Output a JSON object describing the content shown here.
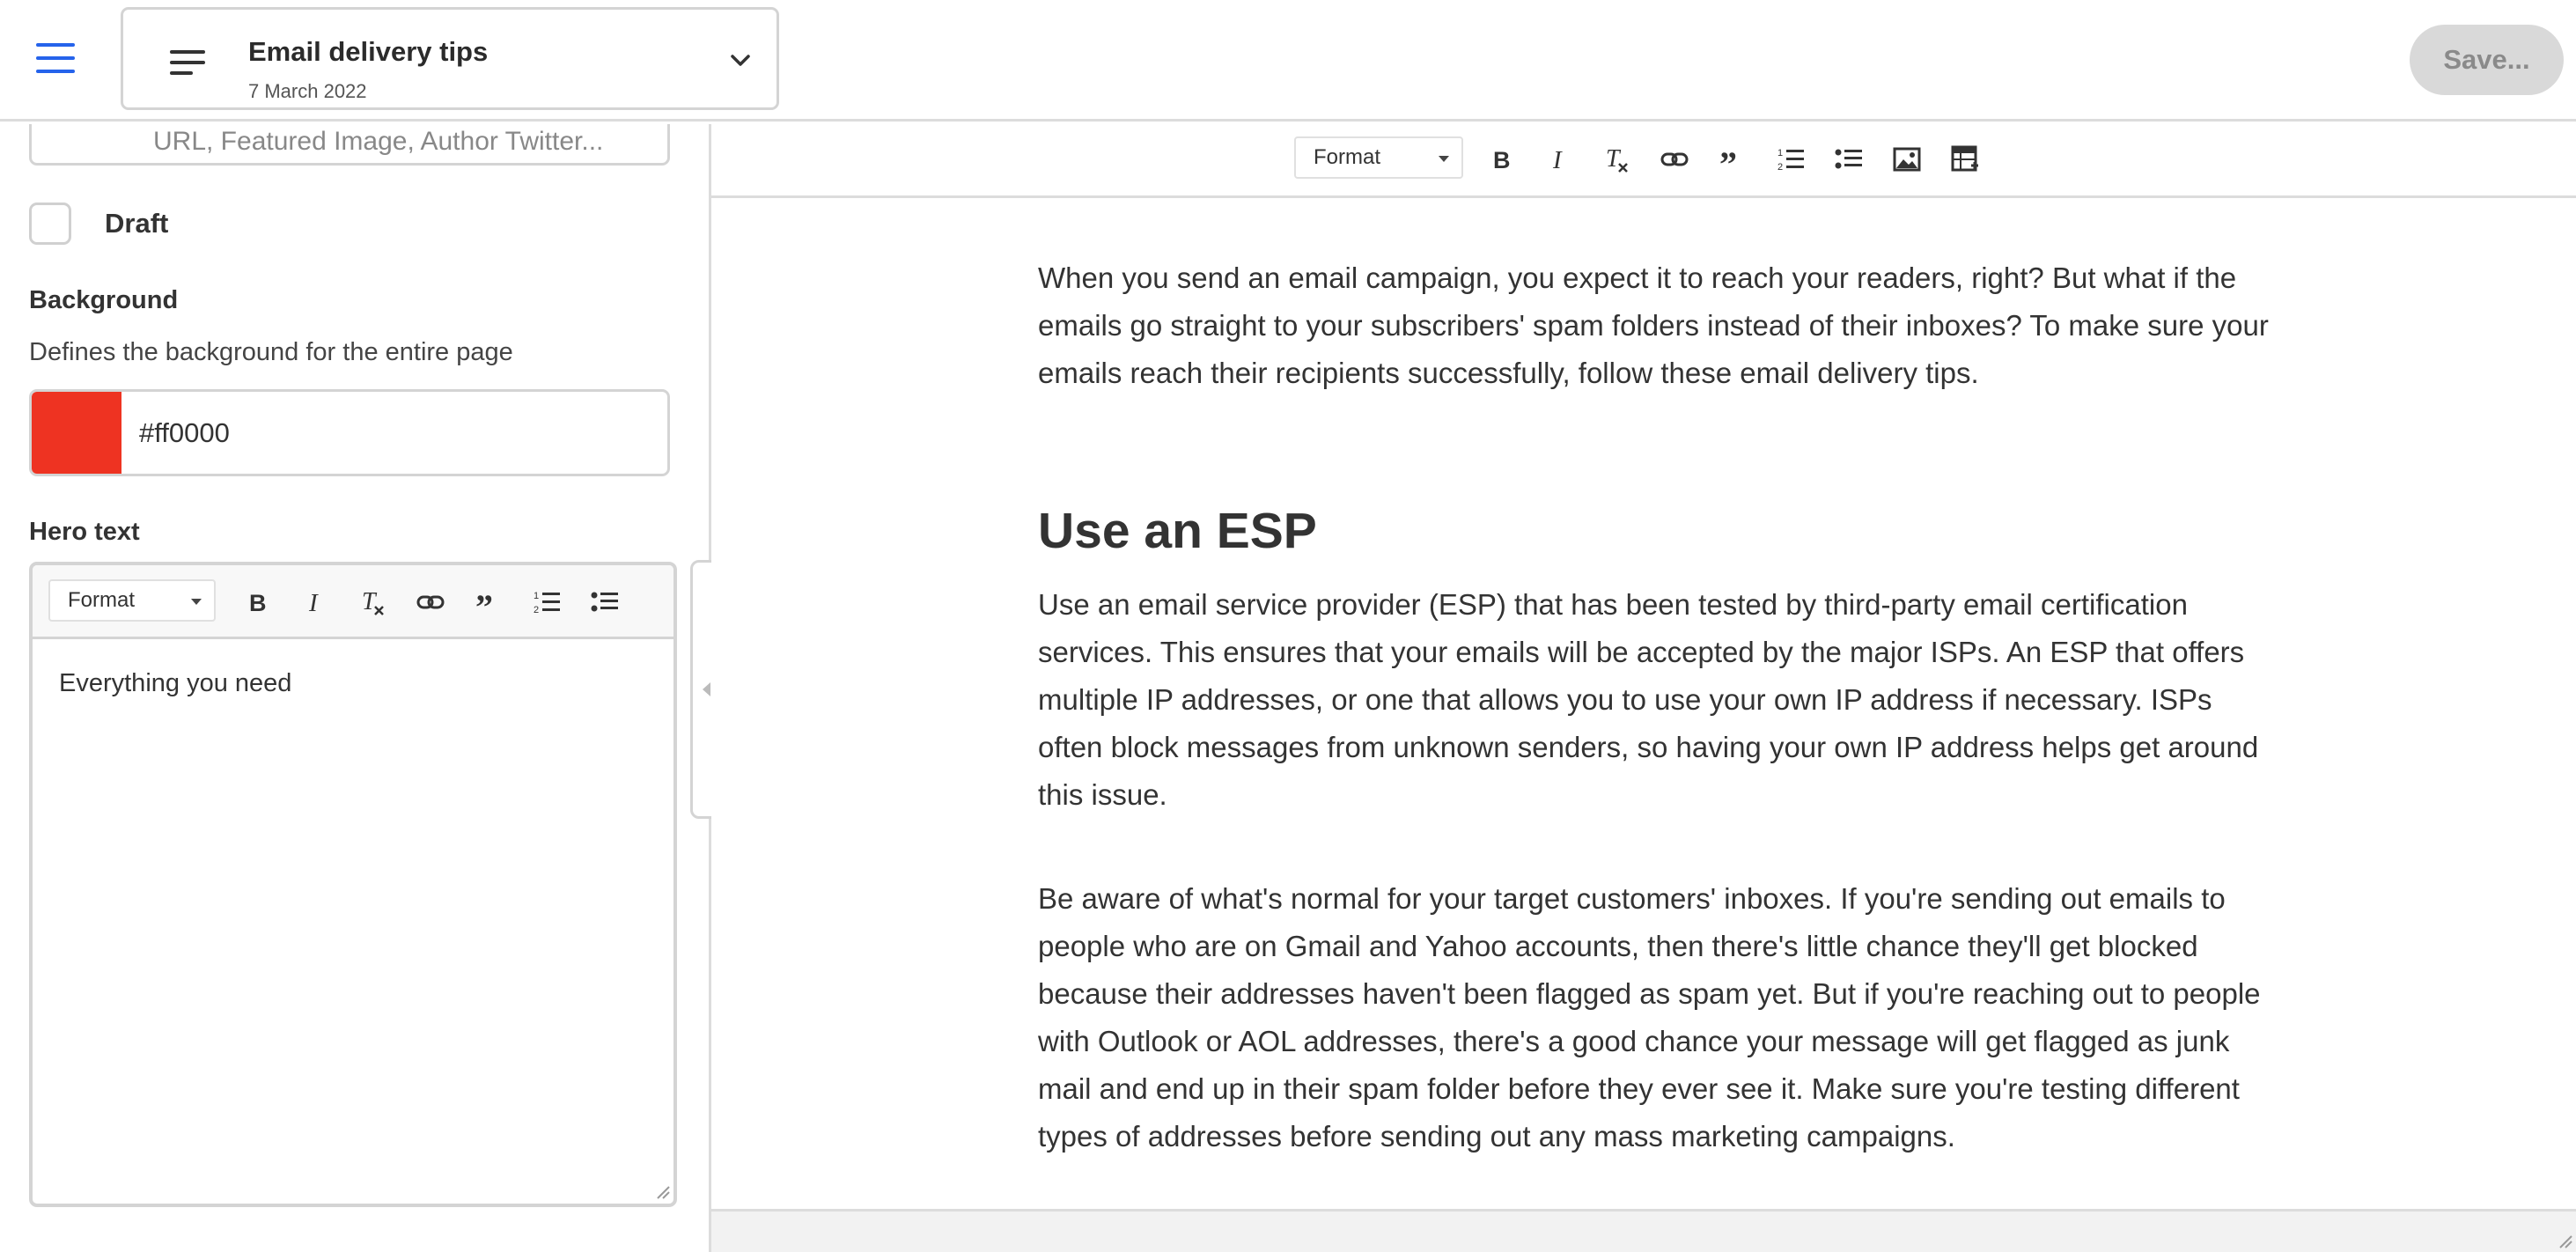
{
  "topbar": {
    "doc_title": "Email delivery tips",
    "doc_date": "7 March 2022",
    "save_label": "Save..."
  },
  "sidebar": {
    "meta_text": "URL, Featured Image, Author Twitter...",
    "draft_label": "Draft",
    "draft_checked": false,
    "background": {
      "label": "Background",
      "description": "Defines the background for the entire page",
      "value": "#ff0000",
      "swatch_color": "#ee3322"
    },
    "hero": {
      "label": "Hero text",
      "format_label": "Format",
      "content": "Everything you need"
    }
  },
  "toolbar": {
    "format_label": "Format",
    "icons": [
      "bold-icon",
      "italic-icon",
      "clear-format-icon",
      "link-icon",
      "blockquote-icon",
      "numbered-list-icon",
      "bulleted-list-icon",
      "image-icon",
      "table-icon"
    ]
  },
  "article": {
    "intro": "When you send an email campaign, you expect it to reach your readers, right? But what if the emails go straight to your subscribers' spam folders instead of their inboxes? To make sure your emails reach their recipients successfully, follow these email delivery tips.",
    "heading": "Use an ESP",
    "p1": "Use an email service provider (ESP) that has been tested by third-party email certification services. This ensures that your emails will be accepted by the major ISPs. An ESP that offers multiple IP addresses, or one that allows you to use your own IP address if necessary. ISPs often block messages from unknown senders, so having your own IP address helps get around this issue.",
    "p2": "Be aware of what's normal for your target customers' inboxes. If you're sending out emails to people who are on Gmail and Yahoo accounts, then there's little chance they'll get blocked because their addresses haven't been flagged as spam yet. But if you're reaching out to people with Outlook or AOL addresses, there's a good chance your message will get flagged as junk mail and end up in their spam folder before they ever see it. Make sure you're testing different types of addresses before sending out any mass marketing campaigns."
  },
  "colors": {
    "accent": "#2563eb",
    "border": "#d4d4d4",
    "save_bg": "#d9d9d9"
  }
}
